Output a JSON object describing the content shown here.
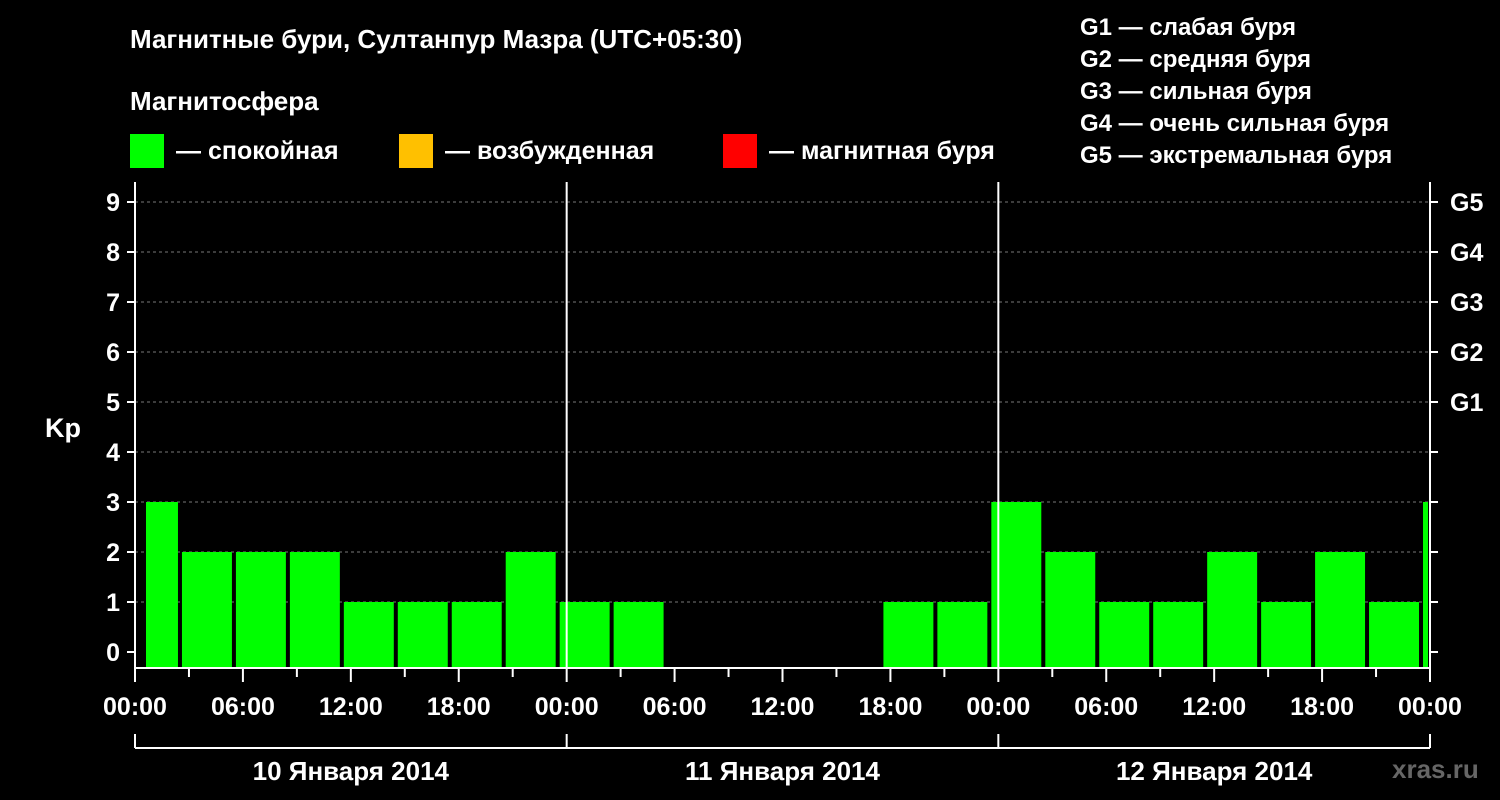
{
  "header": {
    "title": "Магнитные бури, Султанпур Мазра (UTC+05:30)",
    "subtitle": "Магнитосфера",
    "legend": [
      {
        "label": "— спокойная",
        "color": "#00ff00"
      },
      {
        "label": "— возбужденная",
        "color": "#ffc000"
      },
      {
        "label": "— магнитная буря",
        "color": "#ff0000"
      }
    ],
    "g_scale": [
      "G1 — слабая буря",
      "G2 — средняя буря",
      "G3 — сильная буря",
      "G4 — очень сильная буря",
      "G5 — экстремальная буря"
    ]
  },
  "chart_data": {
    "type": "bar",
    "ylabel": "Kp",
    "ylim": [
      0,
      9
    ],
    "y_ticks": [
      0,
      1,
      2,
      3,
      4,
      5,
      6,
      7,
      8,
      9
    ],
    "g_ticks": [
      {
        "kp": 5,
        "label": "G1"
      },
      {
        "kp": 6,
        "label": "G2"
      },
      {
        "kp": 7,
        "label": "G3"
      },
      {
        "kp": 8,
        "label": "G4"
      },
      {
        "kp": 9,
        "label": "G5"
      }
    ],
    "x_tick_labels": [
      "00:00",
      "06:00",
      "12:00",
      "18:00",
      "00:00",
      "06:00",
      "12:00",
      "18:00",
      "00:00",
      "06:00",
      "12:00",
      "18:00",
      "00:00"
    ],
    "days": [
      "10 Января 2014",
      "11 Января 2014",
      "12 Января 2014"
    ],
    "bar_color": "#00ff00",
    "bars": [
      {
        "start": "10.01.2014 00:30",
        "end": "10.01.2014 02:30",
        "kp": 3
      },
      {
        "start": "10.01.2014 02:30",
        "end": "10.01.2014 05:30",
        "kp": 2
      },
      {
        "start": "10.01.2014 05:30",
        "end": "10.01.2014 08:30",
        "kp": 2
      },
      {
        "start": "10.01.2014 08:30",
        "end": "10.01.2014 11:30",
        "kp": 2
      },
      {
        "start": "10.01.2014 11:30",
        "end": "10.01.2014 14:30",
        "kp": 1
      },
      {
        "start": "10.01.2014 14:30",
        "end": "10.01.2014 17:30",
        "kp": 1
      },
      {
        "start": "10.01.2014 17:30",
        "end": "10.01.2014 20:30",
        "kp": 1
      },
      {
        "start": "10.01.2014 20:30",
        "end": "10.01.2014 23:30",
        "kp": 2
      },
      {
        "start": "10.01.2014 23:30",
        "end": "11.01.2014 02:30",
        "kp": 1
      },
      {
        "start": "11.01.2014 02:30",
        "end": "11.01.2014 05:30",
        "kp": 1
      },
      {
        "start": "11.01.2014 05:30",
        "end": "11.01.2014 08:30",
        "kp": 0
      },
      {
        "start": "11.01.2014 08:30",
        "end": "11.01.2014 11:30",
        "kp": 0
      },
      {
        "start": "11.01.2014 11:30",
        "end": "11.01.2014 14:30",
        "kp": 0
      },
      {
        "start": "11.01.2014 14:30",
        "end": "11.01.2014 17:30",
        "kp": 0
      },
      {
        "start": "11.01.2014 17:30",
        "end": "11.01.2014 20:30",
        "kp": 1
      },
      {
        "start": "11.01.2014 20:30",
        "end": "11.01.2014 23:30",
        "kp": 1
      },
      {
        "start": "11.01.2014 23:30",
        "end": "12.01.2014 02:30",
        "kp": 3
      },
      {
        "start": "12.01.2014 02:30",
        "end": "12.01.2014 05:30",
        "kp": 2
      },
      {
        "start": "12.01.2014 05:30",
        "end": "12.01.2014 08:30",
        "kp": 1
      },
      {
        "start": "12.01.2014 08:30",
        "end": "12.01.2014 11:30",
        "kp": 1
      },
      {
        "start": "12.01.2014 11:30",
        "end": "12.01.2014 14:30",
        "kp": 2
      },
      {
        "start": "12.01.2014 14:30",
        "end": "12.01.2014 17:30",
        "kp": 1
      },
      {
        "start": "12.01.2014 17:30",
        "end": "12.01.2014 20:30",
        "kp": 2
      },
      {
        "start": "12.01.2014 20:30",
        "end": "12.01.2014 23:30",
        "kp": 1
      },
      {
        "start": "12.01.2014 23:30",
        "end": "13.01.2014 00:00",
        "kp": 3
      }
    ]
  },
  "watermark": "xras.ru"
}
